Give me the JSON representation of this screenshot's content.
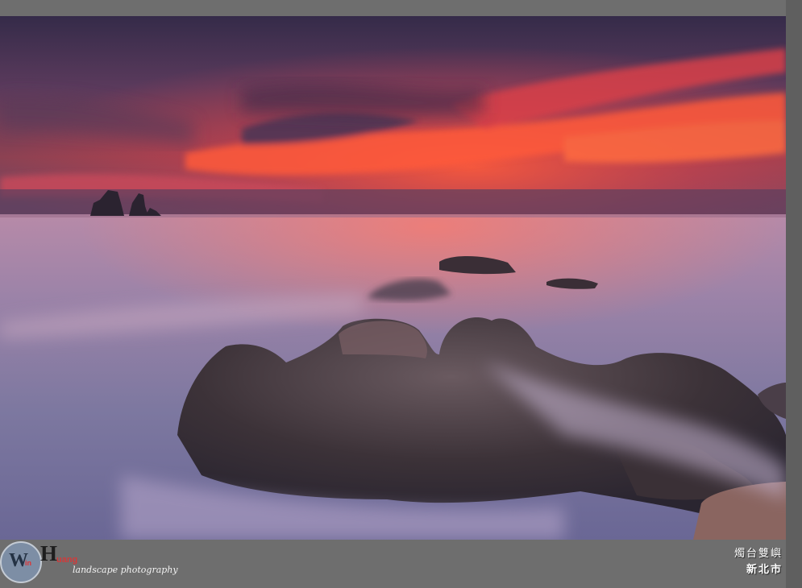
{
  "watermark": {
    "logo_w": "W",
    "logo_in": "in",
    "logo_h": "H",
    "logo_uang": "uang",
    "tagline": "landscape photography"
  },
  "caption": {
    "location": "燭台雙嶼",
    "city": "新北市"
  },
  "colors": {
    "frame": "#6e6e6e",
    "sky_top": "#3b3150",
    "sunset_glow": "#f0503a",
    "sea": "#8a7a9e",
    "rocks": "#3a3238"
  }
}
